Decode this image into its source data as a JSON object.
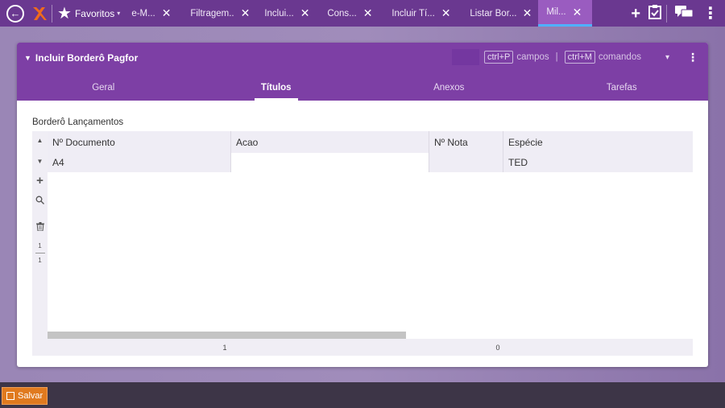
{
  "topbar": {
    "favorites_label": "Favoritos",
    "tabs": [
      {
        "label": "e-M..."
      },
      {
        "label": "Filtragem..."
      },
      {
        "label": "Inclui..."
      },
      {
        "label": "Cons..."
      },
      {
        "label": "Incluir Tí..."
      },
      {
        "label": "Listar Bor..."
      },
      {
        "label": "Mil..."
      }
    ],
    "close_glyph": "✕"
  },
  "panel": {
    "title": "Incluir Borderô Pagfor",
    "shortcut_fields_key": "ctrl+P",
    "shortcut_fields_label": "campos",
    "shortcut_commands_key": "ctrl+M",
    "shortcut_commands_label": "comandos",
    "tabs": [
      {
        "label": "Geral"
      },
      {
        "label": "Títulos"
      },
      {
        "label": "Anexos"
      },
      {
        "label": "Tarefas"
      }
    ],
    "active_tab": "Títulos"
  },
  "section": {
    "label": "Borderô Lançamentos"
  },
  "grid": {
    "columns": [
      {
        "label": "Nº Documento"
      },
      {
        "label": "Acao"
      },
      {
        "label": "Nº Nota"
      },
      {
        "label": "Espécie"
      }
    ],
    "rows": [
      {
        "documento": "A4",
        "acao": "",
        "nota": "",
        "especie": "TED"
      }
    ],
    "side": {
      "count_top": "1",
      "count_bottom": "1"
    },
    "footer": {
      "left_value": "1",
      "right_value": "0"
    }
  },
  "bottombar": {
    "save_label": "Salvar"
  },
  "colors": {
    "topbar": "#6a3890",
    "panel_header": "#7d3fa5",
    "active_tab": "#9a5cc0",
    "save_button": "#e07a1f"
  }
}
